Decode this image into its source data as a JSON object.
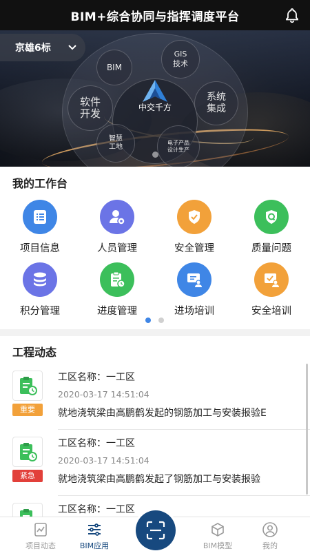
{
  "header": {
    "title": "BIM+综合协同与指挥调度平台"
  },
  "banner": {
    "project": "京雄6标",
    "center_label": "中交千方",
    "bubbles": {
      "bim": "BIM",
      "gis_1": "GIS",
      "gis_2": "技术",
      "soft_1": "软件",
      "soft_2": "开发",
      "sys_1": "系统",
      "sys_2": "集成",
      "wis_1": "智慧",
      "wis_2": "工地",
      "ele_1": "电子产品",
      "ele_2": "设计生产"
    }
  },
  "workbench": {
    "title": "我的工作台",
    "items": [
      {
        "label": "项目信息",
        "icon": "list-icon",
        "color": "#3f86e6"
      },
      {
        "label": "人员管理",
        "icon": "user-gear-icon",
        "color": "#6b74e6"
      },
      {
        "label": "安全管理",
        "icon": "shield-check-icon",
        "color": "#f2a13a"
      },
      {
        "label": "质量问题",
        "icon": "shield-q-icon",
        "color": "#3cbf5b"
      },
      {
        "label": "积分管理",
        "icon": "coins-icon",
        "color": "#6b74e6"
      },
      {
        "label": "进度管理",
        "icon": "clipboard-clock-icon",
        "color": "#3cbf5b"
      },
      {
        "label": "进场培训",
        "icon": "training-board-icon",
        "color": "#3f86e6"
      },
      {
        "label": "安全培训",
        "icon": "safety-training-icon",
        "color": "#f2a13a"
      }
    ],
    "pager": {
      "active_color": "#3f86e6",
      "inactive_color": "#d0d0d0"
    }
  },
  "news": {
    "title": "工程动态",
    "items": [
      {
        "site": "工区名称：一工区",
        "time": "2020-03-17 14:51:04",
        "tag": "重要",
        "tag_color": "#f2a13a",
        "desc": "就地浇筑梁由高鹏鹤发起的钢筋加工与安装报验E"
      },
      {
        "site": "工区名称：一工区",
        "time": "2020-03-17 14:51:04",
        "tag": "紧急",
        "tag_color": "#e2403a",
        "desc": "就地浇筑梁由高鹏鹤发起了钢筋加工与安装报验"
      },
      {
        "site": "工区名称：一工区",
        "time": "",
        "tag": "",
        "tag_color": "#f2a13a",
        "desc": ""
      }
    ]
  },
  "nav": {
    "items": [
      {
        "label": "项目动态",
        "icon": "chart-doc-icon"
      },
      {
        "label": "BIM应用",
        "icon": "sliders-icon"
      },
      {
        "label": "BIM模型",
        "icon": "cube-icon"
      },
      {
        "label": "我的",
        "icon": "person-icon"
      }
    ],
    "active_color": "#17497f",
    "inactive_color": "#9a9a9a",
    "scan_icon": "scan-icon"
  }
}
